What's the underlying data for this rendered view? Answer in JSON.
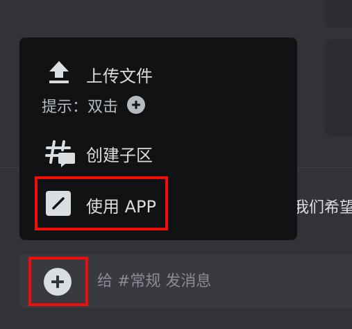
{
  "popup_menu": {
    "upload_file": {
      "label": "上传文件",
      "hint": "提示：双击",
      "icon": "upload-icon",
      "hint_icon": "plus-circle-icon"
    },
    "create_thread": {
      "label": "创建子区",
      "icon": "thread-icon"
    },
    "use_app": {
      "label": "使用 APP",
      "icon": "app-icon"
    }
  },
  "chat_input": {
    "placeholder": "给 #常规 发消息",
    "attach_icon": "plus-circle-icon"
  },
  "background_message": {
    "text": "我们希望"
  },
  "colors": {
    "background": "#313338",
    "menu_background": "#111214",
    "input_background": "#383a40",
    "text_primary": "#dbdee1",
    "text_muted": "#8a8d93",
    "highlight": "#f20c0c"
  }
}
